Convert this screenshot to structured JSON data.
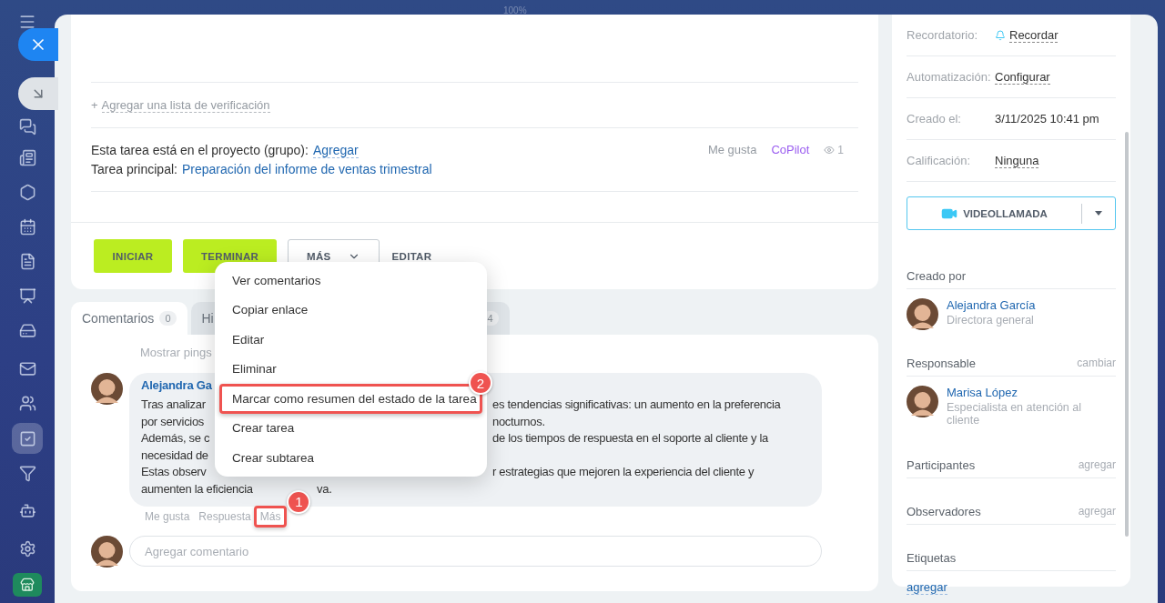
{
  "zoom_label": "100%",
  "sidebar": {
    "items": [
      {
        "selected": false
      },
      {
        "selected": false
      },
      {
        "selected": false
      },
      {
        "selected": false
      },
      {
        "selected": false
      },
      {
        "selected": false
      },
      {
        "selected": false
      },
      {
        "selected": false
      },
      {
        "selected": false
      },
      {
        "selected": true
      },
      {
        "selected": false
      },
      {
        "selected": false
      },
      {
        "selected": false
      },
      {
        "selected": false
      }
    ]
  },
  "task": {
    "checklist_plus": "+",
    "checklist_link": "Agregar una lista de verificación",
    "project_label": "Esta tarea está en el proyecto (grupo):",
    "project_link": "Agregar",
    "parent_label": "Tarea principal:",
    "parent_link": "Preparación del informe de ventas trimestral",
    "like": "Me gusta",
    "copilot": "CoPilot",
    "views": "1"
  },
  "actions": [
    {
      "label": "INICIAR",
      "kind": "primary"
    },
    {
      "label": "TERMINAR",
      "kind": "primary"
    },
    {
      "label": "MÁS",
      "kind": "dropdown"
    },
    {
      "label": "EDITAR",
      "kind": "link"
    }
  ],
  "tabs": [
    {
      "label": "Comentarios",
      "count": "0",
      "selected": true
    },
    {
      "label": "Hi",
      "selected": false
    },
    {
      "count": "4",
      "selected": false
    }
  ],
  "pings": "Mostrar pings",
  "comment": {
    "author": "Alejandra Ga",
    "lines": [
      {
        "left": "Tras analizar",
        "right": "es tendencias significativas: un aumento en la preferencia",
        "kind": "split"
      },
      {
        "left": "por servicios",
        "right": "nocturnos.",
        "kind": "split"
      },
      {
        "left": "Además, se c",
        "right": "de los tiempos de respuesta en el soporte al cliente y la",
        "kind": "split"
      },
      {
        "left": "necesidad de",
        "kind": "split"
      },
      {
        "left": "Estas observ",
        "right": "r estrategias que mejoren la experiencia del cliente y",
        "kind": "split"
      },
      {
        "left": "aumenten la eficiencia",
        "right": "va.",
        "kind": "tail"
      }
    ],
    "actions": [
      {
        "label": "Me gusta"
      },
      {
        "label": "Respuesta"
      },
      {
        "label": "Más",
        "callout": "1"
      }
    ]
  },
  "new_comment": {
    "placeholder": "Agregar comentario"
  },
  "menu": {
    "items": [
      {
        "label": "Ver comentarios",
        "highlighted": false
      },
      {
        "label": "Copiar enlace",
        "highlighted": false
      },
      {
        "label": "Editar",
        "highlighted": false
      },
      {
        "label": "Eliminar",
        "highlighted": false
      },
      {
        "label": "Marcar como resumen del estado de la tarea",
        "highlighted": true,
        "callout": "2"
      },
      {
        "label": "Crear tarea",
        "highlighted": false
      },
      {
        "label": "Crear subtarea",
        "highlighted": false
      }
    ]
  },
  "details": [
    {
      "label": "Recordatorio:",
      "value": "Recordar",
      "kind": "reminder"
    },
    {
      "label": "Automatización:",
      "value": "Configurar",
      "kind": "link"
    },
    {
      "label": "Creado el:",
      "value": "3/11/2025 10:41 pm",
      "kind": "text"
    },
    {
      "label": "Calificación:",
      "value": "Ninguna",
      "kind": "link"
    }
  ],
  "video_button": "VIDEOLLAMADA",
  "people": [
    {
      "title": "Creado por",
      "name": "Alejandra García",
      "role": "Directora general"
    },
    {
      "title": "Responsable",
      "action": "cambiar",
      "name": "Marisa López",
      "role": "Especialista en atención al cliente"
    }
  ],
  "sections": [
    {
      "title": "Participantes",
      "action": "agregar"
    },
    {
      "title": "Observadores",
      "action": "agregar"
    },
    {
      "title": "Etiquetas"
    }
  ],
  "tags_link": "agregar"
}
